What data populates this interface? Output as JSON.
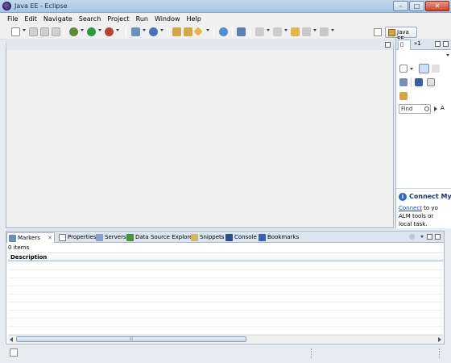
{
  "window": {
    "title": "Java EE - Eclipse"
  },
  "menu": [
    "File",
    "Edit",
    "Navigate",
    "Search",
    "Project",
    "Run",
    "Window",
    "Help"
  ],
  "perspective": {
    "label": "Java EE"
  },
  "right_panel": {
    "tab_overflow": "»1",
    "find_placeholder": "Find",
    "find_all_label": "A",
    "connect_title": "Connect My",
    "connect_link": "Connect",
    "connect_line1_rest": " to yo",
    "connect_line2": "ALM tools or",
    "connect_line3": "local task."
  },
  "bottom_panel": {
    "tabs": [
      "Markers",
      "Properties",
      "Servers",
      "Data Source Explorer",
      "Snippets",
      "Console",
      "Bookmarks"
    ],
    "items_count": "0 items",
    "column_header": "Description",
    "scroll_thumb_grip": "|||"
  },
  "colors": {
    "accent": "#1c4fb3",
    "panel_border": "#a7b5c6",
    "tab_bg": "#dbe5f0"
  },
  "icons": [
    "new-icon",
    "save-icon",
    "debug-icon",
    "run-icon",
    "open-type-icon",
    "search-icon",
    "back-icon",
    "forward-icon"
  ]
}
